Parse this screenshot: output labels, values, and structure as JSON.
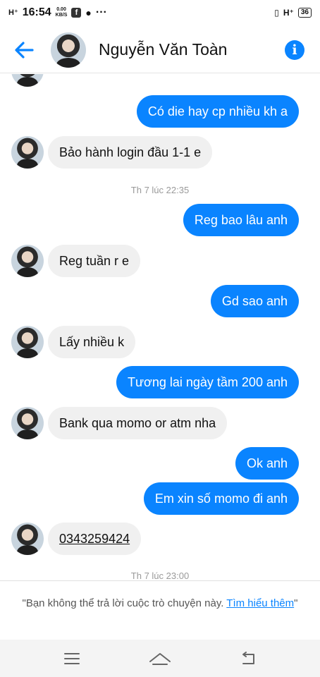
{
  "status_bar": {
    "signal": "H⁺",
    "time": "16:54",
    "speed_value": "0.00",
    "speed_unit": "KB/S",
    "more": "···",
    "network": "H⁺",
    "battery": "36"
  },
  "header": {
    "contact_name": "Nguyễn Văn Toàn"
  },
  "messages": [
    {
      "dir": "out",
      "text": "Có die hay cp nhiều kh a"
    },
    {
      "dir": "in",
      "text": "Bảo hành login đầu 1-1 e"
    },
    {
      "dir": "out",
      "text": "Reg bao lâu anh"
    },
    {
      "dir": "in",
      "text": "Reg tuần r e"
    },
    {
      "dir": "out",
      "text": "Gd sao anh"
    },
    {
      "dir": "in",
      "text": "Lấy nhiều k"
    },
    {
      "dir": "out",
      "text": "Tương lai ngày tầm 200 anh"
    },
    {
      "dir": "in",
      "text": "Bank qua momo or atm nha"
    },
    {
      "dir": "out",
      "text": "Ok anh"
    },
    {
      "dir": "out",
      "text": "Em xin số momo đi anh"
    },
    {
      "dir": "in",
      "text": "0343259424"
    }
  ],
  "timestamps": [
    "Th 7 lúc 22:35",
    "Th 7 lúc 23:00"
  ],
  "notice": {
    "text": "\"Bạn không thể trả lời cuộc trò chuyện này. ",
    "link": "Tìm hiểu thêm",
    "end": "\""
  },
  "colors": {
    "accent": "#0a84ff",
    "incoming_bubble": "#f0f0f0"
  },
  "icons": {
    "back": "arrow-left-icon",
    "info": "info-icon",
    "menu": "menu-icon",
    "home": "home-icon",
    "return": "back-icon"
  }
}
